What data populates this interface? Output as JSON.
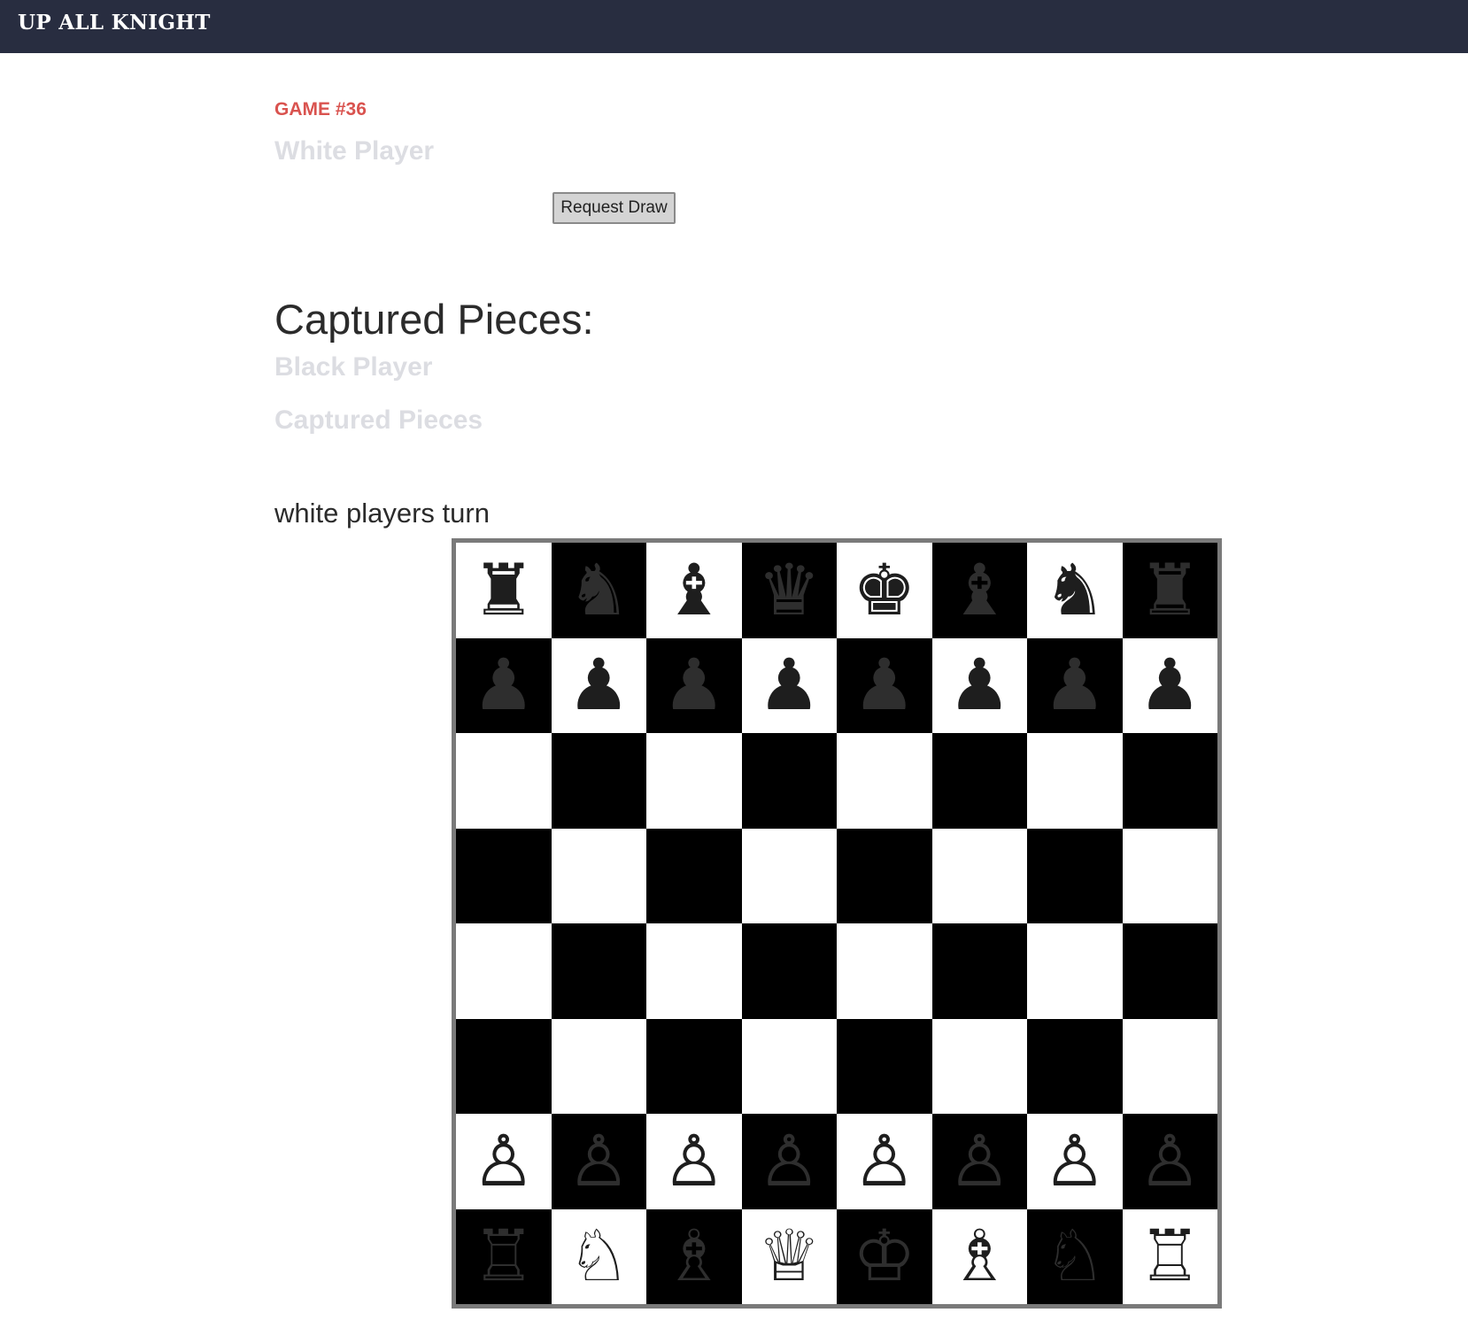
{
  "app": {
    "brand": "UP ALL KNIGHT"
  },
  "game": {
    "number_label": "GAME #36",
    "white_player": "White Player",
    "black_player": "Black Player",
    "request_draw_label": "Request Draw",
    "captured_title": "Captured Pieces:",
    "captured_pieces_label": "Captured Pieces",
    "turn_text": "white players turn"
  },
  "colors": {
    "header_bg": "#282d40",
    "game_number": "#d9534f",
    "player_name": "#dcdde2",
    "light_square": "#ffffff",
    "dark_square": "#000000"
  },
  "board": {
    "top_left_square": "light",
    "ranks": [
      [
        {
          "piece": "rook",
          "side": "black",
          "glyph": "♜"
        },
        {
          "piece": "knight",
          "side": "black",
          "glyph": "♞"
        },
        {
          "piece": "bishop",
          "side": "black",
          "glyph": "♝"
        },
        {
          "piece": "queen",
          "side": "black",
          "glyph": "♛"
        },
        {
          "piece": "king",
          "side": "black",
          "glyph": "♚"
        },
        {
          "piece": "bishop",
          "side": "black",
          "glyph": "♝"
        },
        {
          "piece": "knight",
          "side": "black",
          "glyph": "♞"
        },
        {
          "piece": "rook",
          "side": "black",
          "glyph": "♜"
        }
      ],
      [
        {
          "piece": "pawn",
          "side": "black",
          "glyph": "♟"
        },
        {
          "piece": "pawn",
          "side": "black",
          "glyph": "♟"
        },
        {
          "piece": "pawn",
          "side": "black",
          "glyph": "♟"
        },
        {
          "piece": "pawn",
          "side": "black",
          "glyph": "♟"
        },
        {
          "piece": "pawn",
          "side": "black",
          "glyph": "♟"
        },
        {
          "piece": "pawn",
          "side": "black",
          "glyph": "♟"
        },
        {
          "piece": "pawn",
          "side": "black",
          "glyph": "♟"
        },
        {
          "piece": "pawn",
          "side": "black",
          "glyph": "♟"
        }
      ],
      [
        null,
        null,
        null,
        null,
        null,
        null,
        null,
        null
      ],
      [
        null,
        null,
        null,
        null,
        null,
        null,
        null,
        null
      ],
      [
        null,
        null,
        null,
        null,
        null,
        null,
        null,
        null
      ],
      [
        null,
        null,
        null,
        null,
        null,
        null,
        null,
        null
      ],
      [
        {
          "piece": "pawn",
          "side": "white",
          "glyph": "♙"
        },
        {
          "piece": "pawn",
          "side": "white",
          "glyph": "♙"
        },
        {
          "piece": "pawn",
          "side": "white",
          "glyph": "♙"
        },
        {
          "piece": "pawn",
          "side": "white",
          "glyph": "♙"
        },
        {
          "piece": "pawn",
          "side": "white",
          "glyph": "♙"
        },
        {
          "piece": "pawn",
          "side": "white",
          "glyph": "♙"
        },
        {
          "piece": "pawn",
          "side": "white",
          "glyph": "♙"
        },
        {
          "piece": "pawn",
          "side": "white",
          "glyph": "♙"
        }
      ],
      [
        {
          "piece": "rook",
          "side": "white",
          "glyph": "♖"
        },
        {
          "piece": "knight",
          "side": "white",
          "glyph": "♘"
        },
        {
          "piece": "bishop",
          "side": "white",
          "glyph": "♗"
        },
        {
          "piece": "queen",
          "side": "white",
          "glyph": "♕"
        },
        {
          "piece": "king",
          "side": "white",
          "glyph": "♔"
        },
        {
          "piece": "bishop",
          "side": "white",
          "glyph": "♗"
        },
        {
          "piece": "knight",
          "side": "white",
          "glyph": "♘"
        },
        {
          "piece": "rook",
          "side": "white",
          "glyph": "♖"
        }
      ]
    ]
  }
}
